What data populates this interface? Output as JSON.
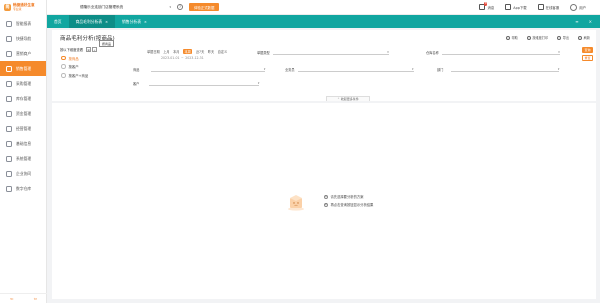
{
  "brand": {
    "logo_char": "简",
    "line1": "畅捷通好生意",
    "line2": "专业版"
  },
  "sidebar": {
    "items": [
      {
        "label": "智能报表"
      },
      {
        "label": "快捷导航"
      },
      {
        "label": "营销商户"
      },
      {
        "label": "销售管理"
      },
      {
        "label": "采购管理"
      },
      {
        "label": "库存管理"
      },
      {
        "label": "资金管理"
      },
      {
        "label": "经营管理"
      },
      {
        "label": "基础信息"
      },
      {
        "label": "系统管理"
      },
      {
        "label": "企业协同"
      },
      {
        "label": "数字仓库"
      }
    ],
    "active_index": 3,
    "bottom_left": "⇐",
    "bottom_right": "⇦"
  },
  "topbar": {
    "org_name": "德隆乐业连锁门店管理系统",
    "help": "?",
    "switch_label": "体验正式数据",
    "items": [
      {
        "label": "消息",
        "badge": "8"
      },
      {
        "label": "App下载"
      },
      {
        "label": "在线客服"
      },
      {
        "label": "用户"
      }
    ]
  },
  "tabs": [
    {
      "label": "首页",
      "closable": false
    },
    {
      "label": "商品毛利分析表",
      "closable": true
    },
    {
      "label": "销售分析表",
      "closable": true
    }
  ],
  "tabbar_icons": {
    "menu": "≡",
    "close": "×"
  },
  "page": {
    "title": "商品毛利分析(按商品)",
    "actions": [
      {
        "label": "帮助"
      },
      {
        "label": "按维度打印"
      },
      {
        "label": "导出"
      },
      {
        "label": "刷新"
      }
    ]
  },
  "filters": {
    "group_label": "按以下维度查看",
    "tooltip": "按商品",
    "dimensions": [
      {
        "label": "按商品",
        "selected": true
      },
      {
        "label": "按客户",
        "selected": false
      },
      {
        "label": "按客户+商品",
        "selected": false
      }
    ],
    "date_label": "单据日期",
    "date_options": [
      "上月",
      "本月",
      "本周",
      "近7天",
      "昨天",
      "自定义"
    ],
    "date_selected_index": 2,
    "date_from": "2023-01-01",
    "date_to": "2023-12-31",
    "fields": {
      "goods": "商品",
      "customer": "客户",
      "doc_type": "单据类型",
      "salesperson": "业务员",
      "warehouse": "仓库名称",
      "department": "部门"
    },
    "query_label": "查询",
    "reset_label": "重置",
    "collapse_label": "收起更多条件"
  },
  "empty_state": {
    "hints": [
      "请先选择要分析的方案",
      "再点击查询按钮显示分析结果"
    ]
  },
  "colors": {
    "accent": "#f58a2b",
    "teal": "#11a6a0"
  }
}
